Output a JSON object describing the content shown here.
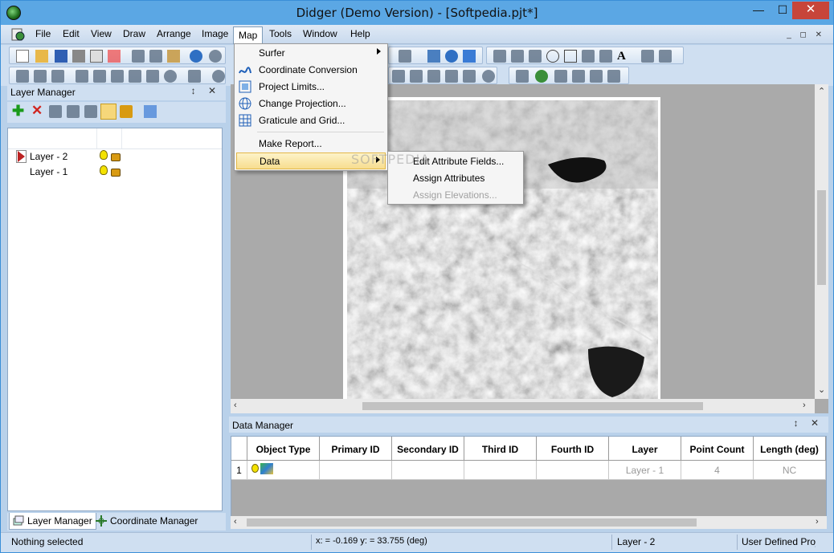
{
  "window": {
    "title": "Didger (Demo Version) - [Softpedia.pjt*]",
    "controls": {
      "minimize": "—",
      "maximize": "☐",
      "close": "✕"
    }
  },
  "menubar": {
    "items": [
      "File",
      "Edit",
      "View",
      "Draw",
      "Arrange",
      "Image",
      "Map",
      "Tools",
      "Window",
      "Help"
    ],
    "active": "Map",
    "mdi_controls": "_ ◻ ✕"
  },
  "map_menu": {
    "items": [
      {
        "label": "Surfer",
        "icon": "none",
        "submenu": true
      },
      {
        "label": "Coordinate Conversion",
        "icon": "coordinate-conversion-icon",
        "submenu": false
      },
      {
        "label": "Project Limits...",
        "icon": "project-limits-icon",
        "submenu": false
      },
      {
        "label": "Change Projection...",
        "icon": "globe-icon",
        "submenu": false
      },
      {
        "label": "Graticule and Grid...",
        "icon": "graticule-icon",
        "submenu": false
      },
      {
        "label": "Make Report...",
        "icon": "none",
        "submenu": false
      },
      {
        "label": "Data",
        "icon": "none",
        "submenu": true,
        "highlighted": true
      }
    ]
  },
  "data_submenu": {
    "items": [
      {
        "label": "Edit Attribute Fields...",
        "enabled": true
      },
      {
        "label": "Assign Attributes",
        "enabled": true
      },
      {
        "label": "Assign Elevations...",
        "enabled": false
      }
    ]
  },
  "watermark": "SOFTPEDIA",
  "layer_manager": {
    "title": "Layer Manager",
    "pane_controls": "↕ ✕",
    "layers": [
      {
        "name": "Layer - 2",
        "current": true
      },
      {
        "name": "Layer - 1",
        "current": false
      }
    ],
    "tabs": [
      {
        "label": "Layer Manager",
        "active": true
      },
      {
        "label": "Coordinate Manager",
        "active": false
      }
    ]
  },
  "data_manager": {
    "title": "Data Manager",
    "pane_controls": "↕ ✕",
    "columns": [
      "",
      "Object Type",
      "Primary ID",
      "Secondary ID",
      "Third ID",
      "Fourth ID",
      "Layer",
      "Point Count",
      "Length (deg)"
    ],
    "rows": [
      {
        "num": "1",
        "object_type": "",
        "primary_id": "",
        "secondary_id": "",
        "third_id": "",
        "fourth_id": "",
        "layer": "Layer - 1",
        "point_count": "4",
        "length": "NC"
      }
    ]
  },
  "statusbar": {
    "selection": "Nothing selected",
    "coordinates": "x: = -0.169 y: = 33.755 (deg)",
    "layer": "Layer - 2",
    "projection": "User Defined Proj"
  },
  "colors": {
    "title_bar": "#5ba7e4",
    "close_button": "#c7453a",
    "chrome": "#cfdff1",
    "menu_highlight": "#f7dd8f"
  }
}
